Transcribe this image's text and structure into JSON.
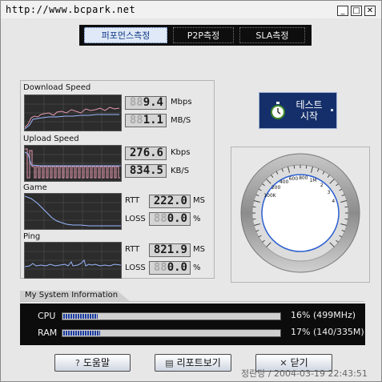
{
  "title": {
    "url": "http://www.bcpark.net"
  },
  "window_buttons": {
    "minimize": "_",
    "maximize": "□",
    "close": "✕"
  },
  "tabs": [
    {
      "label": "퍼포먼스측정",
      "active": true
    },
    {
      "label": "P2P측정",
      "active": false
    },
    {
      "label": "SLA측정",
      "active": false
    }
  ],
  "metrics": {
    "download": {
      "title": "Download Speed",
      "readout1": {
        "ghost": "88",
        "value": "9.4",
        "unit": "Mbps"
      },
      "readout2": {
        "ghost": "88",
        "value": "1.1",
        "unit": "MB/S"
      }
    },
    "upload": {
      "title": "Upload Speed",
      "readout1": {
        "ghost": "",
        "value": "276.6",
        "unit": "Kbps"
      },
      "readout2": {
        "ghost": "",
        "value": "834.5",
        "unit": "KB/S"
      }
    },
    "game": {
      "title": "Game",
      "rtt": {
        "label": "RTT",
        "ghost": "",
        "value": "222.0",
        "unit": "MS"
      },
      "loss": {
        "label": "LOSS",
        "ghost": "88",
        "value": "0.0",
        "unit": "%"
      }
    },
    "ping": {
      "title": "Ping",
      "rtt": {
        "label": "RTT",
        "ghost": "",
        "value": "821.9",
        "unit": "MS"
      },
      "loss": {
        "label": "LOSS",
        "ghost": "88",
        "value": "0.0",
        "unit": "%"
      }
    }
  },
  "test_button": {
    "label": "테스트 시작",
    "icon": "stopwatch-icon"
  },
  "gauge": {
    "ticks": [
      "100K",
      "200",
      "400",
      "600",
      "800",
      "1M",
      "2",
      "3",
      "4"
    ]
  },
  "system": {
    "title": "My System Information",
    "cpu": {
      "label": "CPU",
      "percent": 16,
      "text": "16% (499MHz)"
    },
    "ram": {
      "label": "RAM",
      "percent": 17,
      "text": "17% (140/335M)"
    }
  },
  "buttons": {
    "help": {
      "label": "도움말",
      "icon": "help-icon"
    },
    "report": {
      "label": "리포트보기",
      "icon": "report-icon"
    },
    "close": {
      "label": "닫기",
      "icon": "close-icon"
    }
  },
  "status": {
    "text": "정란당 / 2004-03-19 22:43:51"
  },
  "colors": {
    "accent": "#152f6a",
    "graph_bg": "#2c2c2c",
    "bar_fill": "#1a3ca0"
  }
}
